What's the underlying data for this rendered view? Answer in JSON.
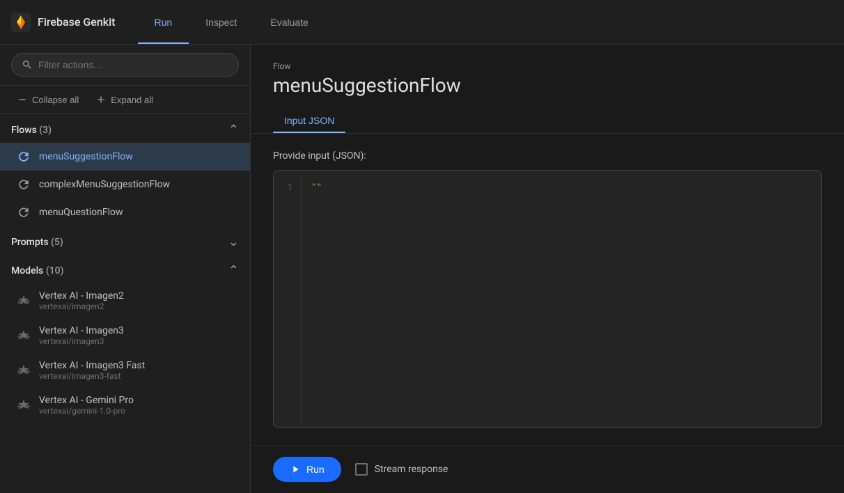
{
  "app": {
    "logo_text": "Firebase Genkit"
  },
  "nav": {
    "tabs": [
      {
        "id": "run",
        "label": "Run",
        "active": true
      },
      {
        "id": "inspect",
        "label": "Inspect",
        "active": false
      },
      {
        "id": "evaluate",
        "label": "Evaluate",
        "active": false
      }
    ]
  },
  "sidebar": {
    "search_placeholder": "Filter actions...",
    "collapse_label": "Collapse all",
    "expand_label": "Expand all",
    "sections": [
      {
        "id": "flows",
        "title": "Flows",
        "count": "(3)",
        "expanded": true,
        "items": [
          {
            "id": "menuSuggestionFlow",
            "label": "menuSuggestionFlow",
            "active": true
          },
          {
            "id": "complexMenuSuggestionFlow",
            "label": "complexMenuSuggestionFlow",
            "active": false
          },
          {
            "id": "menuQuestionFlow",
            "label": "menuQuestionFlow",
            "active": false
          }
        ]
      },
      {
        "id": "prompts",
        "title": "Prompts",
        "count": "(5)",
        "expanded": false,
        "items": []
      },
      {
        "id": "models",
        "title": "Models",
        "count": "(10)",
        "expanded": true,
        "items": [
          {
            "id": "vertexai-imagen2",
            "label": "Vertex AI - Imagen2",
            "sublabel": "vertexai/imagen2"
          },
          {
            "id": "vertexai-imagen3",
            "label": "Vertex AI - Imagen3",
            "sublabel": "vertexai/imagen3"
          },
          {
            "id": "vertexai-imagen3-fast",
            "label": "Vertex AI - Imagen3 Fast",
            "sublabel": "vertexai/imagen3-fast"
          },
          {
            "id": "vertexai-gemini-pro",
            "label": "Vertex AI - Gemini Pro",
            "sublabel": "vertexai/gemini-1.0-pro"
          }
        ]
      }
    ]
  },
  "panel": {
    "breadcrumb": "Flow",
    "title": "menuSuggestionFlow",
    "tabs": [
      {
        "id": "input-json",
        "label": "Input JSON",
        "active": true
      }
    ],
    "input_label": "Provide input (JSON):",
    "code_line_1": "1",
    "code_content": "\"\"",
    "run_button_label": "Run",
    "stream_response_label": "Stream response"
  }
}
